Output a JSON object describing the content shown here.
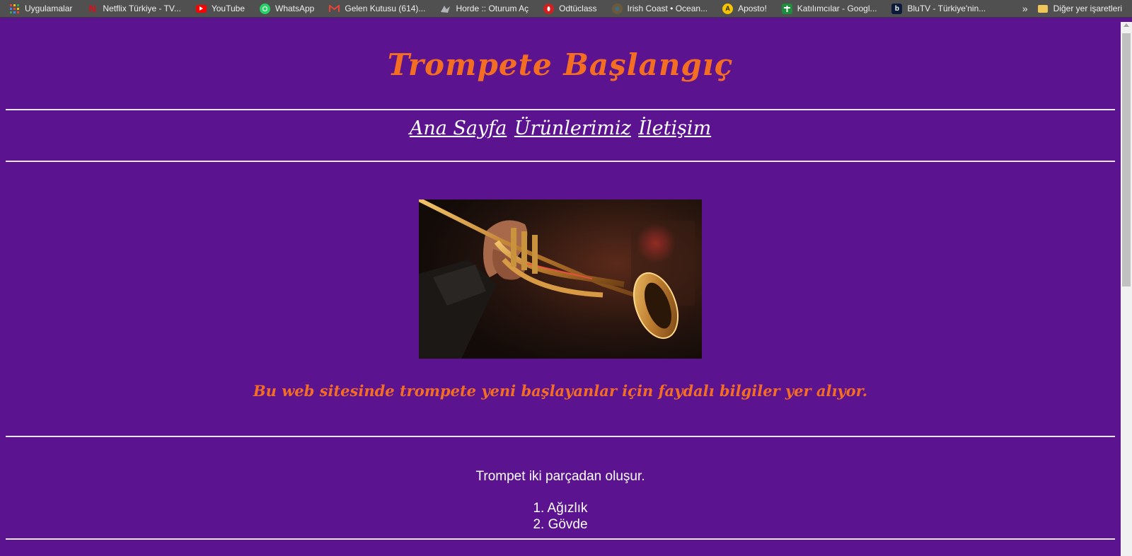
{
  "bookmarks": {
    "items": [
      {
        "label": "Uygulamalar",
        "icon": "apps-grid-icon"
      },
      {
        "label": "Netflix Türkiye - TV...",
        "icon": "netflix-icon",
        "color": "#e50914"
      },
      {
        "label": "YouTube",
        "icon": "youtube-icon",
        "color": "#ff0000"
      },
      {
        "label": "WhatsApp",
        "icon": "whatsapp-icon",
        "color": "#25d366"
      },
      {
        "label": "Gelen Kutusu (614)...",
        "icon": "gmail-icon",
        "color": "#ea4335"
      },
      {
        "label": "Horde :: Oturum Aç",
        "icon": "horde-icon",
        "color": "#9aa0a6"
      },
      {
        "label": "Odtüclass",
        "icon": "odtuclass-icon",
        "color": "#d21f1f"
      },
      {
        "label": "Irish Coast • Ocean...",
        "icon": "ocean-icon",
        "color": "#6b5a3a"
      },
      {
        "label": "Aposto!",
        "icon": "aposto-icon",
        "color": "#f5c400"
      },
      {
        "label": "Katılımcılar - Googl...",
        "icon": "classroom-icon",
        "color": "#1e8e3e"
      },
      {
        "label": "BluTV - Türkiye'nin...",
        "icon": "blutv-icon",
        "color": "#0b1a3a"
      }
    ],
    "overflow_label": "»",
    "other_bookmarks": "Diğer yer işaretleri"
  },
  "page": {
    "title": "Trompete Başlangıç",
    "nav": [
      "Ana Sayfa",
      "Ürünlerimiz",
      "İletişim"
    ],
    "tagline": "Bu web sitesinde trompete yeni başlayanlar için faydalı bilgiler yer alıyor.",
    "intro": "Trompet iki parçadan oluşur.",
    "parts": [
      "Ağızlık",
      "Gövde"
    ]
  },
  "colors": {
    "background": "#5b1390",
    "accent": "#f36e22",
    "text": "#ffffff"
  }
}
